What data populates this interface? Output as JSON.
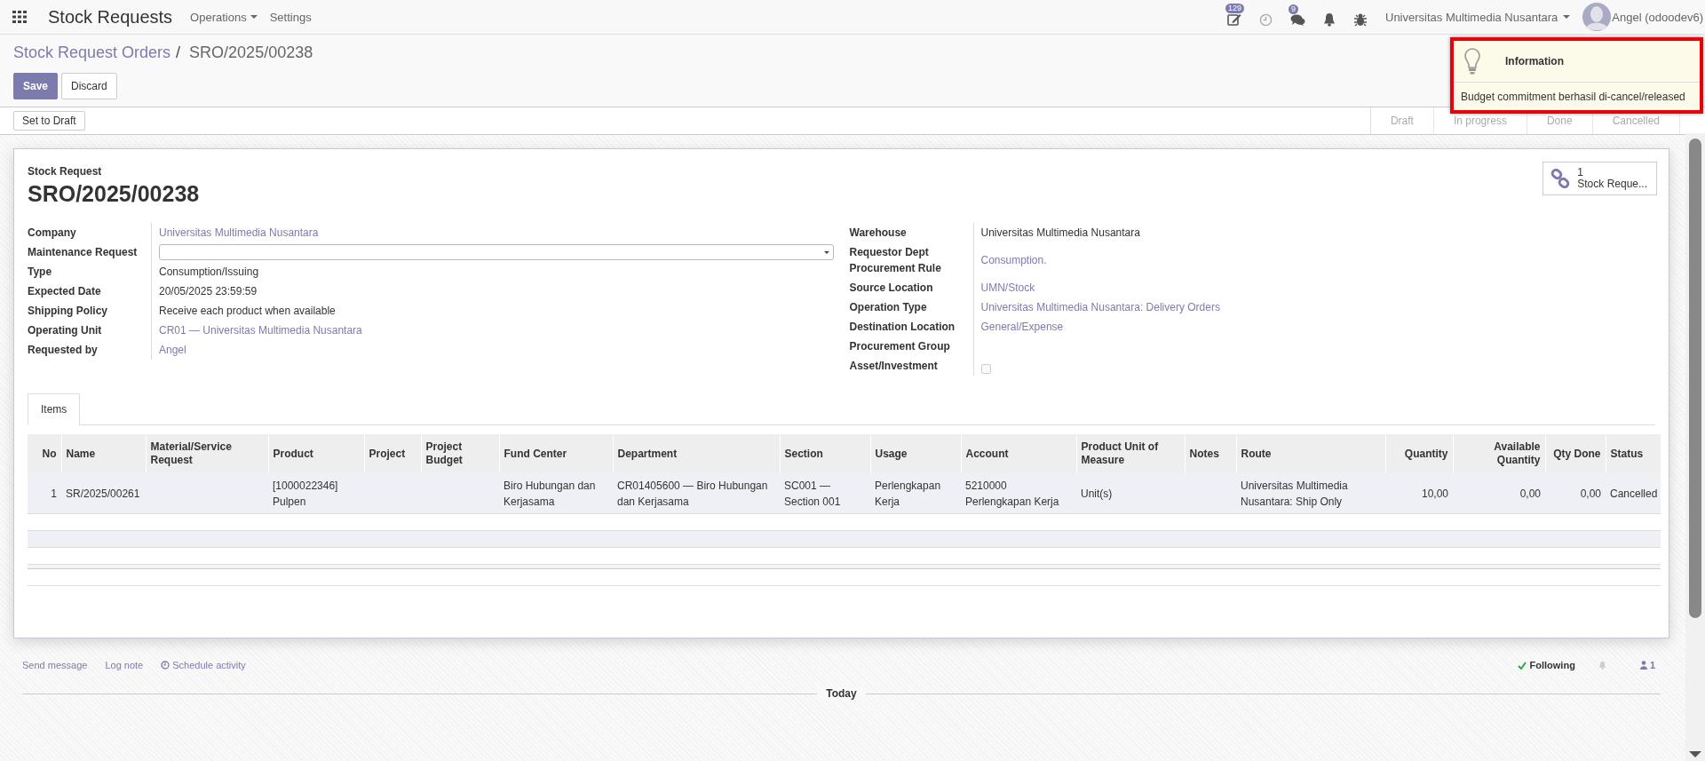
{
  "navbar": {
    "app_title": "Stock Requests",
    "menus": [
      {
        "label": "Operations",
        "dropdown": true
      },
      {
        "label": "Settings",
        "dropdown": false
      }
    ],
    "activity_badge": "129",
    "messages_badge": "9",
    "company": "Universitas Multimedia Nusantara",
    "user": "Angel (odoodev6)"
  },
  "breadcrumb": {
    "parent": "Stock Request Orders",
    "separator": "/",
    "current": "SRO/2025/00238"
  },
  "buttons": [
    "Save",
    "Discard"
  ],
  "header_buttons": [
    "Set to Draft"
  ],
  "statusbar": [
    "Draft",
    "In progress",
    "Done",
    "Cancelled"
  ],
  "notification": {
    "title": "Information",
    "message": "Budget commitment berhasil di-cancel/released"
  },
  "sheet": {
    "subtitle": "Stock Request",
    "title": "SRO/2025/00238",
    "smart_button": {
      "count": "1",
      "label": "Stock Reque..."
    },
    "left_fields": [
      {
        "label": "Company",
        "kind": "link",
        "value": "Universitas Multimedia Nusantara"
      },
      {
        "label": "Maintenance Request",
        "kind": "select"
      },
      {
        "label": "Type",
        "kind": "text",
        "value": "Consumption/Issuing"
      },
      {
        "label": "Expected Date",
        "kind": "text",
        "value": "20/05/2025 23:59:59"
      },
      {
        "label": "Shipping Policy",
        "kind": "text",
        "value": "Receive each product when available"
      },
      {
        "label": "Operating Unit",
        "kind": "link",
        "value": "CR01 — Universitas Multimedia Nusantara"
      },
      {
        "label": "Requested by",
        "kind": "link",
        "value": "Angel"
      }
    ],
    "right_fields": [
      {
        "label": "Warehouse",
        "kind": "text",
        "value": "Universitas Multimedia Nusantara"
      },
      {
        "label": "Requestor Dept Procurement Rule",
        "kind": "link",
        "value": "Consumption."
      },
      {
        "label": "Source Location",
        "kind": "link",
        "value": "UMN/Stock"
      },
      {
        "label": "Operation Type",
        "kind": "link",
        "value": "Universitas Multimedia Nusantara: Delivery Orders"
      },
      {
        "label": "Destination Location",
        "kind": "link",
        "value": "General/Expense"
      },
      {
        "label": "Procurement Group",
        "kind": "text"
      },
      {
        "label": "Asset/Investment",
        "kind": "checkbox",
        "checked": false
      }
    ],
    "tabs": [
      {
        "label": "Items",
        "selected": true
      }
    ],
    "table": {
      "columns": [
        "No",
        "Name",
        "Material/Service Request",
        "Product",
        "Project",
        "Project Budget",
        "Fund Center",
        "Department",
        "Section",
        "Usage",
        "Account",
        "Product Unit of Measure",
        "Notes",
        "Route",
        "Quantity",
        "Available Quantity",
        "Qty Done",
        "Status"
      ],
      "rows": [
        [
          "1",
          "SR/2025/00261",
          "",
          "[1000022346] Pulpen",
          "",
          "",
          "Biro Hubungan dan Kerjasama",
          "CR01405600 — Biro Hubungan dan Kerjasama",
          "SC001 — Section 001",
          "Perlengkapan Kerja",
          "5210000 Perlengkapan Kerja",
          "Unit(s)",
          "",
          "Universitas Multimedia Nusantara: Ship Only",
          "10,00",
          "0,00",
          "0,00",
          "Cancelled"
        ]
      ]
    }
  },
  "chatter": {
    "actions": [
      "Send message",
      "Log note",
      "Schedule activity"
    ],
    "following": "Following",
    "followers": "1",
    "date_separator": "Today"
  }
}
